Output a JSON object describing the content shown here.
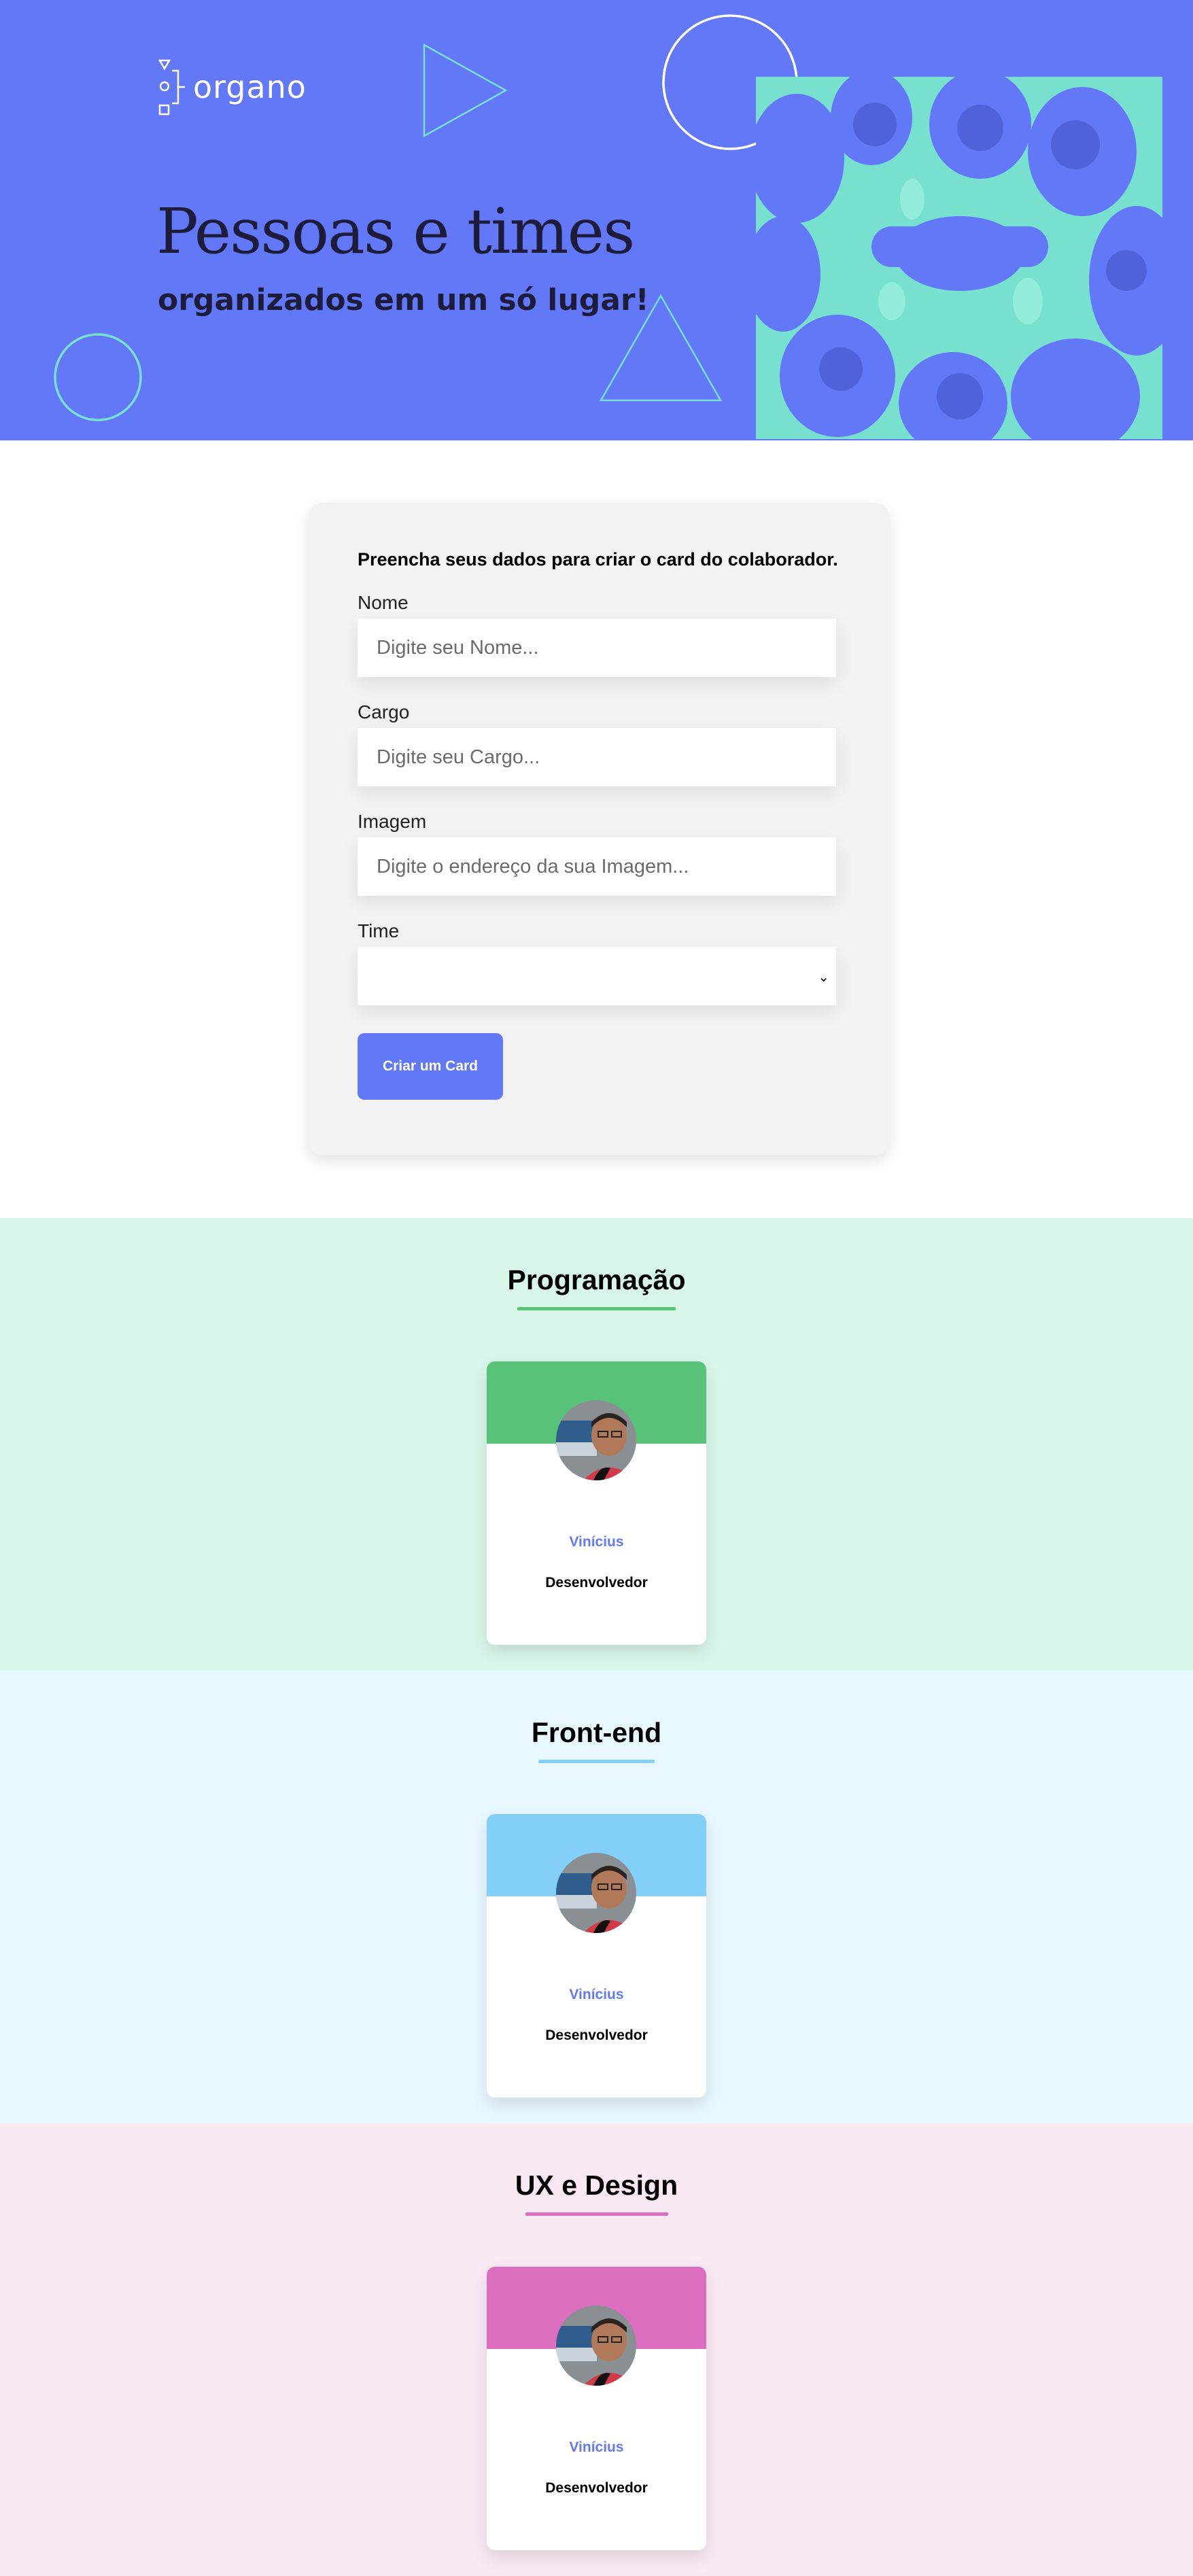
{
  "hero": {
    "logo_text": "organo",
    "title": "Pessoas e times",
    "subtitle": "organizados em um só lugar!"
  },
  "form": {
    "heading": "Preencha seus dados para criar o card do colaborador.",
    "fields": [
      {
        "label": "Nome",
        "placeholder": "Digite seu Nome...",
        "value": ""
      },
      {
        "label": "Cargo",
        "placeholder": "Digite seu Cargo...",
        "value": ""
      },
      {
        "label": "Imagem",
        "placeholder": "Digite o endereço da sua Imagem...",
        "value": ""
      }
    ],
    "select": {
      "label": "Time",
      "value": ""
    },
    "submit_label": "Criar um Card"
  },
  "teams": [
    {
      "title": "Programação",
      "primary_color": "#57C278",
      "secondary_color": "#D9F7E9",
      "members": [
        {
          "name": "Vinícius",
          "role": "Desenvolvedor"
        }
      ]
    },
    {
      "title": "Front-end",
      "primary_color": "#82CFFA",
      "secondary_color": "#E8F8FF",
      "members": [
        {
          "name": "Vinícius",
          "role": "Desenvolvedor"
        }
      ]
    },
    {
      "title": "UX e Design",
      "primary_color": "#DB6EBF",
      "secondary_color": "#FAE9F5",
      "members": [
        {
          "name": "Vinícius",
          "role": "Desenvolvedor"
        }
      ]
    }
  ],
  "colors": {
    "brand": "#6278F7",
    "accent": "#77E0CF"
  }
}
